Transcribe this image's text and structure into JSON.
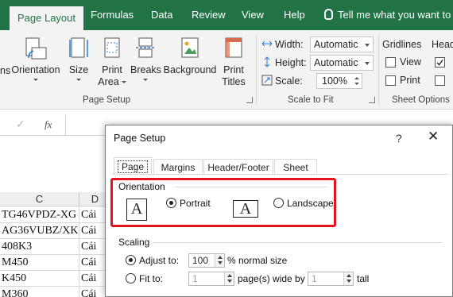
{
  "ribbon_tabs": [
    "Page Layout",
    "Formulas",
    "Data",
    "Review",
    "View",
    "Help"
  ],
  "tell_me": "Tell me what you want to d",
  "page_setup_group": {
    "buttons": [
      {
        "label": "ns"
      },
      {
        "label": "Orientation"
      },
      {
        "label": "Size"
      },
      {
        "label": "Print",
        "label2": "Area"
      },
      {
        "label": "Breaks"
      },
      {
        "label": "Background"
      },
      {
        "label": "Print",
        "label2": "Titles"
      }
    ],
    "label": "Page Setup"
  },
  "scale_to_fit": {
    "width_label": "Width:",
    "width_value": "Automatic",
    "height_label": "Height:",
    "height_value": "Automatic",
    "scale_label": "Scale:",
    "scale_value": "100%",
    "label": "Scale to Fit"
  },
  "sheet_options": {
    "gridlines": "Gridlines",
    "headings": "Headi",
    "view": "View",
    "print": "Print",
    "label": "Sheet Options"
  },
  "formula_bar": {
    "fx": "fx",
    "check": "✓"
  },
  "grid": {
    "col_c": "C",
    "col_d": "D",
    "rows": [
      [
        "TG46VPDZ-XG",
        "Cái"
      ],
      [
        "AG36VUBZ/XK",
        "Cái"
      ],
      [
        "408K3",
        "Cái"
      ],
      [
        "M450",
        "Cái"
      ],
      [
        "K450",
        "Cái"
      ],
      [
        "M360",
        "Cái"
      ]
    ]
  },
  "dialog": {
    "title": "Page Setup",
    "help": "?",
    "close": "✕",
    "tabs": [
      "Page",
      "Margins",
      "Header/Footer",
      "Sheet"
    ],
    "orientation": {
      "label": "Orientation",
      "portrait": "Portrait",
      "landscape": "Landscape",
      "selected": "portrait",
      "paper_glyph": "A"
    },
    "scaling": {
      "label": "Scaling",
      "adjust_to": "Adjust to:",
      "adjust_value": "100",
      "normal_size": "% normal size",
      "fit_to": "Fit to:",
      "fit_wide": "1",
      "pages_wide": "page(s) wide by",
      "fit_tall": "1",
      "tall": "tall"
    }
  },
  "colors": {
    "excel_green": "#217346",
    "highlight_red": "#e5121f"
  }
}
